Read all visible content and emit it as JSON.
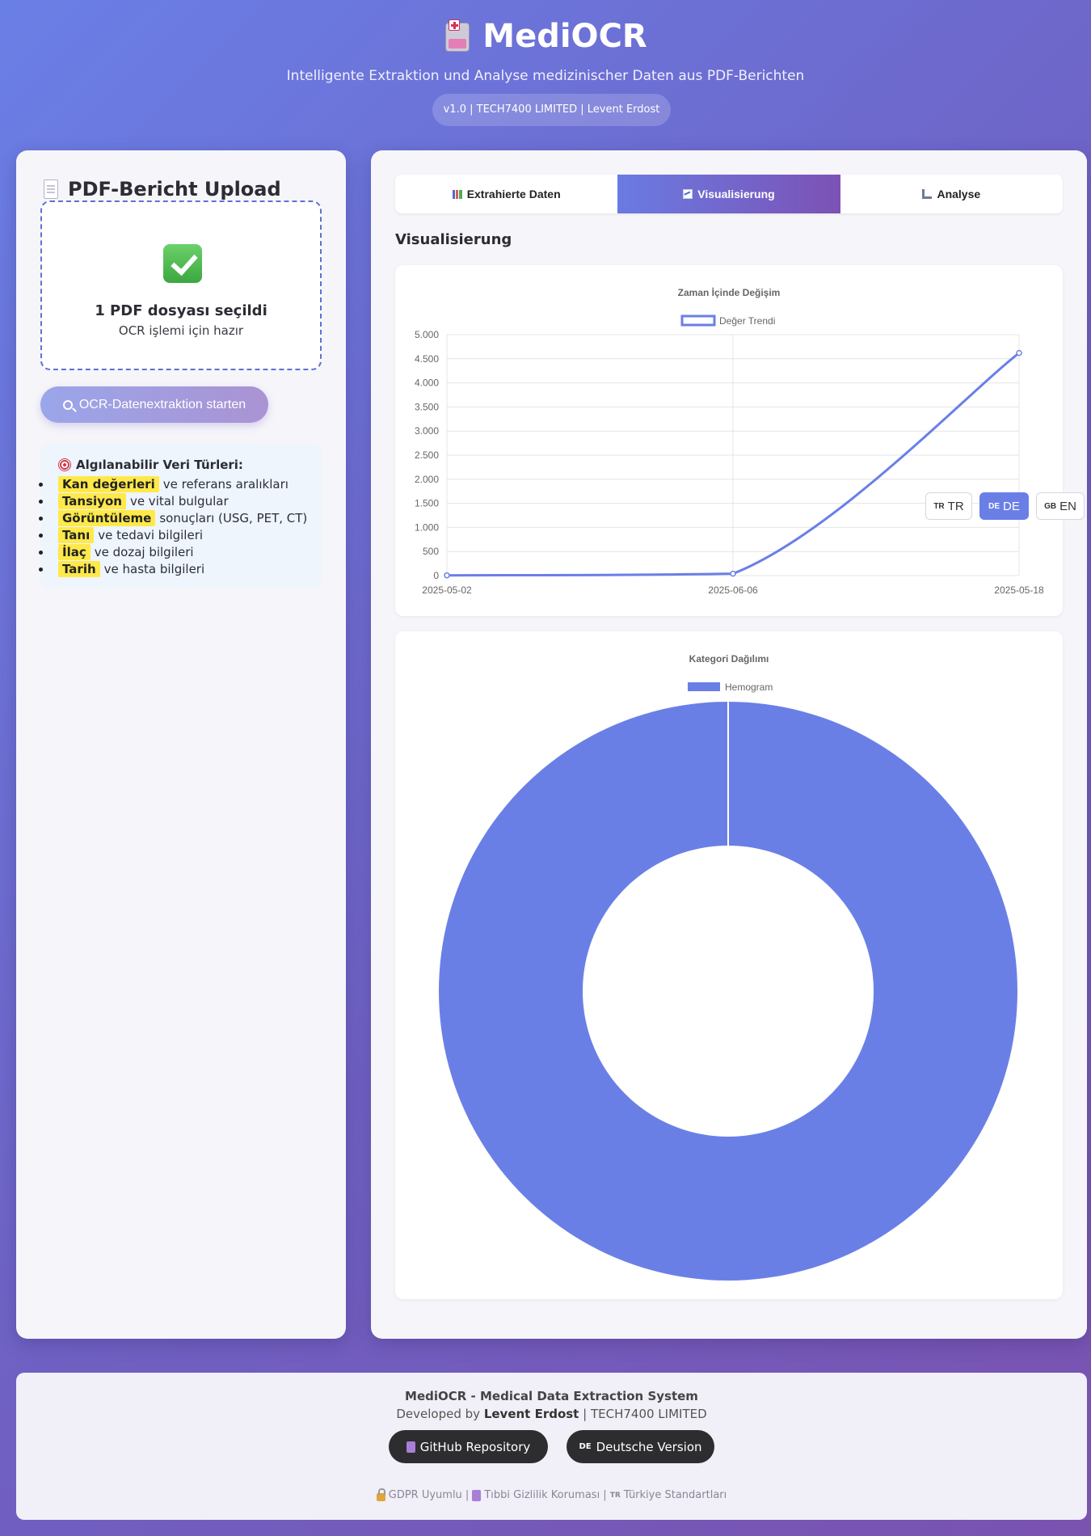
{
  "header": {
    "logo_icon": "medical-cabinet-icon",
    "app_name": "MediOCR",
    "subtitle": "Intelligente Extraktion und Analyse medizinischer Daten aus PDF-Berichten",
    "version": "v1.0 | TECH7400 LIMITED | Levent Erdost"
  },
  "upload": {
    "title": "PDF-Bericht Upload",
    "dropzone_title": "1 PDF dosyası seçildi",
    "dropzone_sub": "OCR işlemi için hazır",
    "ocr_button": "OCR-Datenextraktion starten"
  },
  "types": {
    "title": "Algılanabilir Veri Türleri:",
    "items": [
      {
        "highlight": "Kan değerleri",
        "rest": "ve referans aralıkları"
      },
      {
        "highlight": "Tansiyon",
        "rest": "ve vital bulgular"
      },
      {
        "highlight": "Görüntüleme",
        "rest": "sonuçları (USG, PET, CT)"
      },
      {
        "highlight": "Tanı",
        "rest": "ve tedavi bilgileri"
      },
      {
        "highlight": "İlaç",
        "rest": "ve dozaj bilgileri"
      },
      {
        "highlight": "Tarih",
        "rest": "ve hasta bilgileri"
      }
    ]
  },
  "tabs": [
    {
      "label": "Extrahierte Daten",
      "icon": "bar-chart-icon"
    },
    {
      "label": "Visualisierung",
      "icon": "line-chart-icon",
      "active": true
    },
    {
      "label": "Analyse",
      "icon": "microscope-icon"
    }
  ],
  "section_title": "Visualisierung",
  "language": {
    "tr": {
      "flag": "TR",
      "label": "TR"
    },
    "de": {
      "flag": "DE",
      "label": "DE"
    },
    "en": {
      "flag": "GB",
      "label": "EN"
    },
    "active": "DE"
  },
  "chart_data": [
    {
      "type": "line",
      "title": "Zaman İçinde Değişim",
      "x": [
        "2025-05-02",
        "2025-06-06",
        "2025-05-18"
      ],
      "series": [
        {
          "name": "Değer Trendi",
          "values": [
            5,
            40,
            4620
          ]
        }
      ],
      "ylim": [
        0,
        5000
      ],
      "yticks": [
        "0",
        "500",
        "1.000",
        "1.500",
        "2.000",
        "2.500",
        "3.000",
        "3.500",
        "4.000",
        "4.500",
        "5.000"
      ],
      "grid": true,
      "legend": "top",
      "color": "#6a7fe6"
    },
    {
      "type": "pie",
      "title": "Kategori Dağılımı",
      "labels": [
        "Hemogram"
      ],
      "values": [
        1
      ],
      "legend": "top",
      "color": "#6a7fe6"
    }
  ],
  "footer": {
    "title": "MediOCR - Medical Data Extraction System",
    "dev_prefix": "Developed by",
    "dev_name": "Levent Erdost",
    "dev_suffix": "| TECH7400 LIMITED",
    "github_button": "GitHub Repository",
    "german_flag": "DE",
    "german_button": "Deutsche Version",
    "meta": [
      "GDPR Uyumlu |",
      "Tıbbi Gizlilik Koruması |",
      "Türkiye Standartları"
    ],
    "meta_flag": "TR"
  },
  "colors": {
    "accent": "#6a7fe6",
    "highlight": "#ffe94a",
    "dark_button": "#2d2d2f"
  }
}
